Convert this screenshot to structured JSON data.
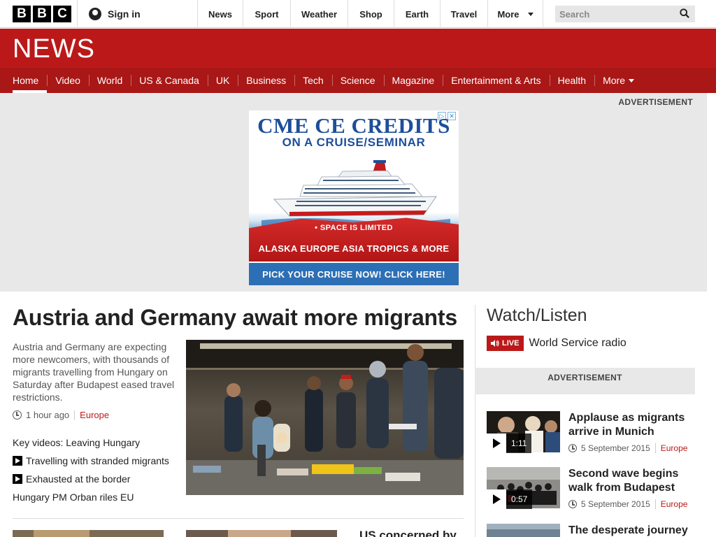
{
  "masthead": {
    "logo_letters": [
      "B",
      "B",
      "C"
    ],
    "signin_label": "Sign in",
    "nav": [
      {
        "label": "News"
      },
      {
        "label": "Sport"
      },
      {
        "label": "Weather"
      },
      {
        "label": "Shop"
      },
      {
        "label": "Earth"
      },
      {
        "label": "Travel"
      },
      {
        "label": "More"
      }
    ],
    "search_placeholder": "Search"
  },
  "section": {
    "title": "NEWS",
    "nav": [
      {
        "label": "Home",
        "active": true
      },
      {
        "label": "Video"
      },
      {
        "label": "World"
      },
      {
        "label": "US & Canada"
      },
      {
        "label": "UK"
      },
      {
        "label": "Business"
      },
      {
        "label": "Tech"
      },
      {
        "label": "Science"
      },
      {
        "label": "Magazine"
      },
      {
        "label": "Entertainment & Arts"
      },
      {
        "label": "Health"
      },
      {
        "label": "More"
      }
    ]
  },
  "ad_band": {
    "label": "ADVERTISEMENT",
    "ad": {
      "headline": "CME CE CREDITS",
      "subheadline": "ON A CRUISE/SEMINAR",
      "note": "• SPACE IS LIMITED",
      "destinations": "ALASKA EUROPE ASIA TROPICS & MORE",
      "cta": "PICK YOUR CRUISE NOW! CLICK HERE!"
    }
  },
  "main_story": {
    "headline": "Austria and Germany await more migrants",
    "summary": "Austria and Germany are expecting more newcomers, with thousands of migrants travelling from Hungary on Saturday after Budapest eased travel restrictions.",
    "time": "1 hour ago",
    "tag": "Europe",
    "links": [
      {
        "label": "Key videos: Leaving Hungary",
        "video": false
      },
      {
        "label": "Travelling with stranded migrants",
        "video": true
      },
      {
        "label": "Exhausted at the border",
        "video": true
      },
      {
        "label": "Hungary PM Orban riles EU",
        "video": false
      }
    ]
  },
  "secondary": {
    "partial_headline": "US concerned by"
  },
  "watch_listen": {
    "title": "Watch/Listen",
    "live_badge": "LIVE",
    "live_label": "World Service radio",
    "ad_label": "ADVERTISEMENT",
    "stories": [
      {
        "headline": "Applause as migrants arrive in Munich",
        "duration": "1:11",
        "date": "5 September 2015",
        "tag": "Europe"
      },
      {
        "headline": "Second wave begins walk from Budapest",
        "duration": "0:57",
        "date": "5 September 2015",
        "tag": "Europe"
      },
      {
        "headline": "The desperate journey"
      }
    ]
  },
  "colors": {
    "brand_red": "#bb1919",
    "subnav_red": "#a91717",
    "ad_background": "#e8e8e8"
  }
}
